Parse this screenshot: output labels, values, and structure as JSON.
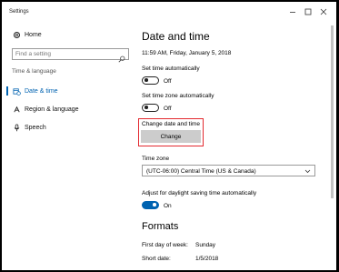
{
  "window": {
    "title": "Settings"
  },
  "sidebar": {
    "home_label": "Home",
    "search_placeholder": "Find a setting",
    "section_label": "Time & language",
    "items": [
      {
        "label": "Date & time",
        "icon": "calendar-clock-icon",
        "active": true
      },
      {
        "label": "Region & language",
        "icon": "language-icon",
        "active": false
      },
      {
        "label": "Speech",
        "icon": "microphone-icon",
        "active": false
      }
    ]
  },
  "main": {
    "title": "Date and time",
    "current_datetime": "11:59 AM, Friday, January 5, 2018",
    "set_time_auto": {
      "label": "Set time automatically",
      "state": "Off"
    },
    "set_timezone_auto": {
      "label": "Set time zone automatically",
      "state": "Off"
    },
    "change_date_time": {
      "label": "Change date and time",
      "button": "Change"
    },
    "time_zone": {
      "label": "Time zone",
      "value": "(UTC-06:00) Central Time (US & Canada)"
    },
    "daylight_saving": {
      "label": "Adjust for daylight saving time automatically",
      "state": "On"
    },
    "formats": {
      "title": "Formats",
      "rows": [
        {
          "label": "First day of week:",
          "value": "Sunday"
        },
        {
          "label": "Short date:",
          "value": "1/5/2018"
        }
      ]
    }
  },
  "colors": {
    "accent": "#0063b1",
    "highlight": "#e3292f"
  }
}
